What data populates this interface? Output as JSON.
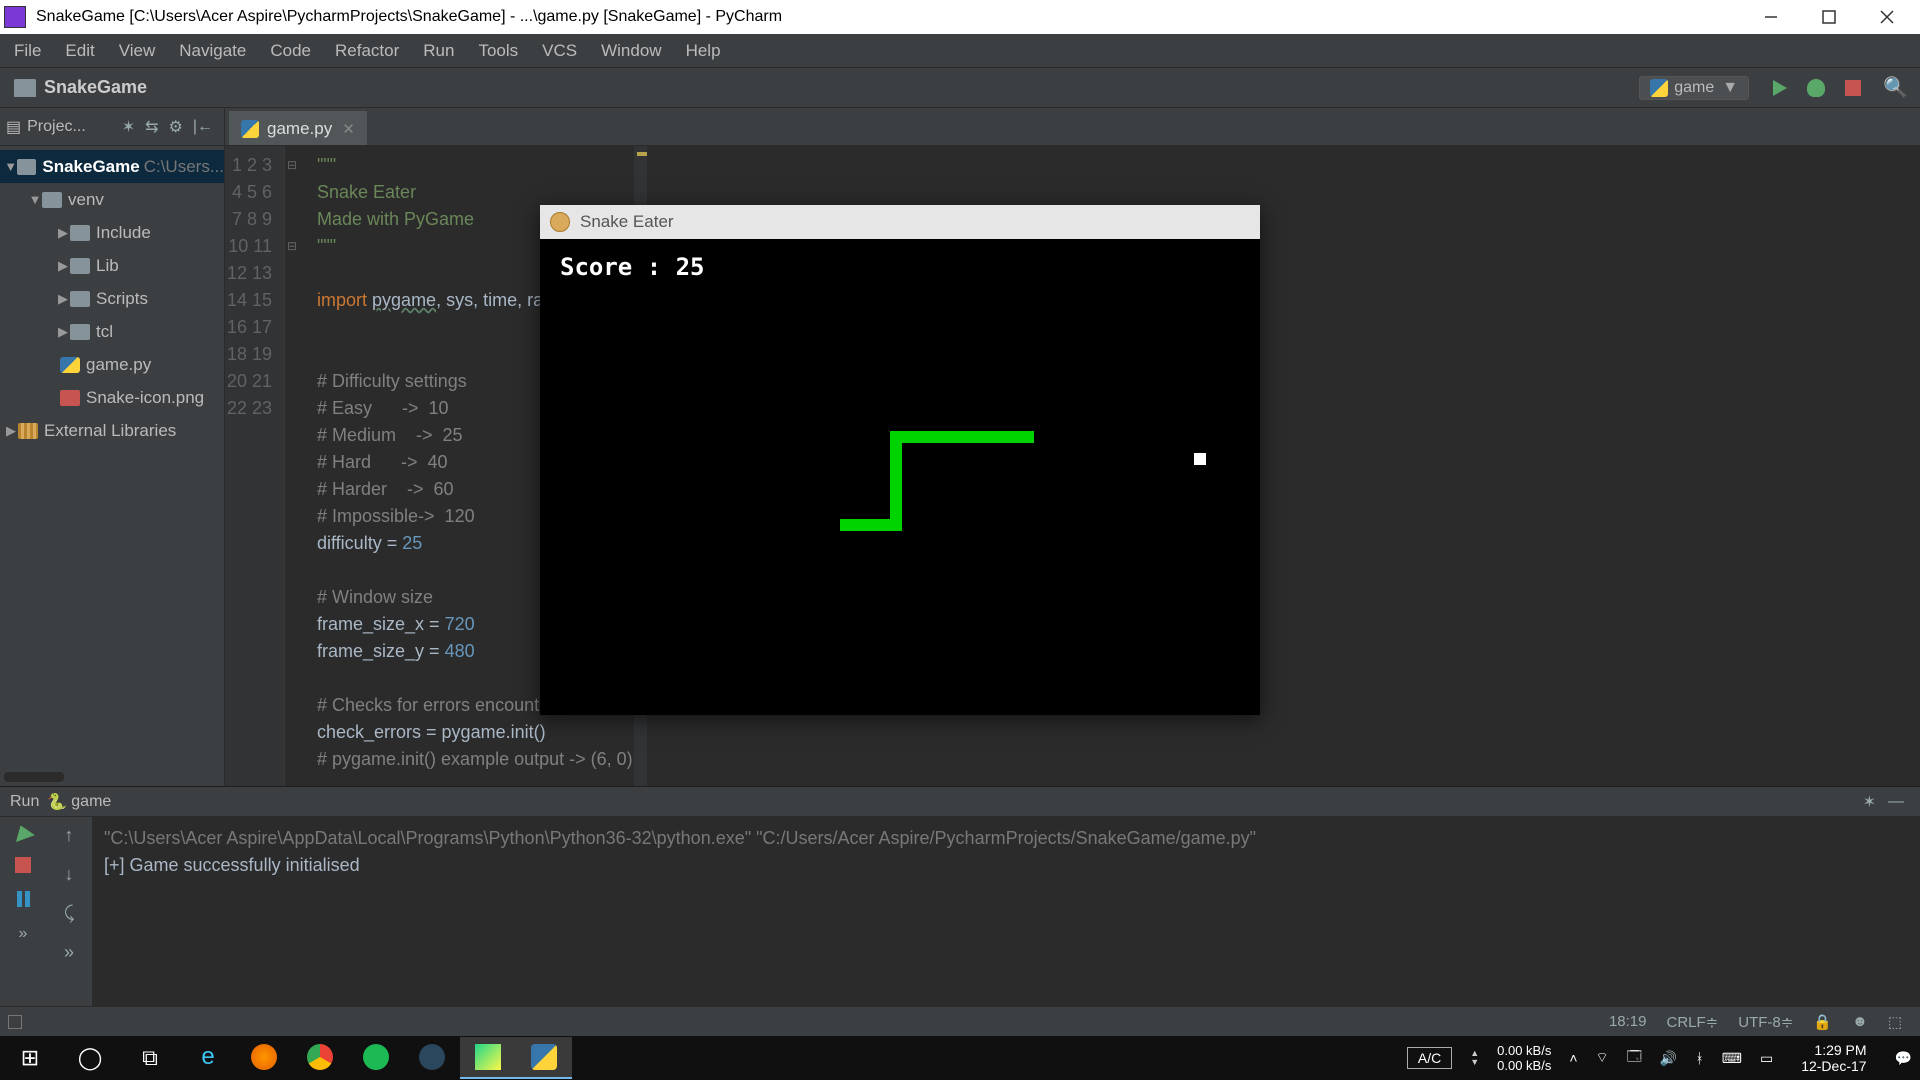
{
  "window": {
    "title": "SnakeGame [C:\\Users\\Acer Aspire\\PycharmProjects\\SnakeGame] - ...\\game.py [SnakeGame] - PyCharm"
  },
  "menu": [
    "File",
    "Edit",
    "View",
    "Navigate",
    "Code",
    "Refactor",
    "Run",
    "Tools",
    "VCS",
    "Window",
    "Help"
  ],
  "breadcrumb": "SnakeGame",
  "run_config": "game",
  "project_tool": {
    "label": "Projec..."
  },
  "tree": {
    "root": {
      "name": "SnakeGame",
      "path": "C:\\Users..."
    },
    "venv": "venv",
    "venv_children": [
      "Include",
      "Lib",
      "Scripts",
      "tcl"
    ],
    "files": [
      "game.py",
      "Snake-icon.png"
    ],
    "ext": "External Libraries"
  },
  "tab": {
    "name": "game.py"
  },
  "code_lines": [
    "\"\"\"",
    "Snake Eater",
    "Made with PyGame",
    "\"\"\"",
    "",
    "import pygame, sys, time, random",
    "",
    "",
    "# Difficulty settings",
    "# Easy      ->  10",
    "# Medium    ->  25",
    "# Hard      ->  40",
    "# Harder    ->  60",
    "# Impossible->  120",
    "difficulty = 25",
    "",
    "# Window size",
    "frame_size_x = 720",
    "frame_size_y = 480",
    "",
    "# Checks for errors encountered",
    "check_errors = pygame.init()",
    "# pygame.init() example output -> (6, 0)"
  ],
  "run": {
    "header": "Run",
    "target": "game",
    "line1": "\"C:\\Users\\Acer Aspire\\AppData\\Local\\Programs\\Python\\Python36-32\\python.exe\" \"C:/Users/Acer Aspire/PycharmProjects/SnakeGame/game.py\"",
    "line2": "[+] Game successfully initialised"
  },
  "status": {
    "time": "18:19",
    "crlf": "CRLF",
    "enc": "UTF-8",
    "lockpad": "a",
    "git": "⎇"
  },
  "taskbar": {
    "ac": "A/C",
    "net_up": "0.00 kB/s",
    "net_dn": "0.00 kB/s",
    "time": "1:29 PM",
    "date": "12-Dec-17"
  },
  "pygame": {
    "title": "Snake Eater",
    "score_label": "Score : 25"
  }
}
